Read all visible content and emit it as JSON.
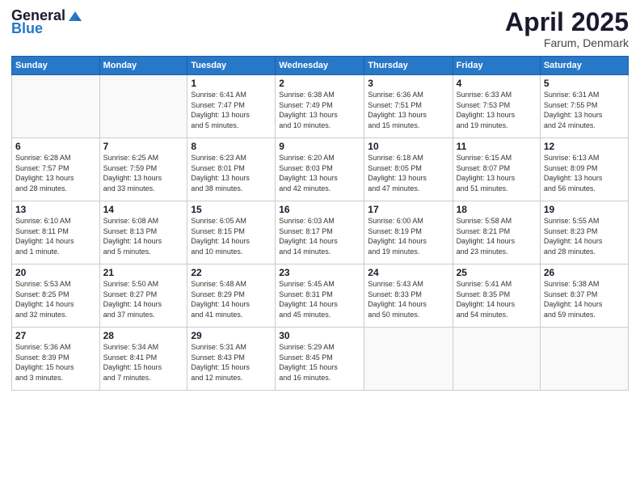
{
  "header": {
    "logo_general": "General",
    "logo_blue": "Blue",
    "month": "April 2025",
    "location": "Farum, Denmark"
  },
  "days_of_week": [
    "Sunday",
    "Monday",
    "Tuesday",
    "Wednesday",
    "Thursday",
    "Friday",
    "Saturday"
  ],
  "weeks": [
    [
      {
        "num": "",
        "info": ""
      },
      {
        "num": "",
        "info": ""
      },
      {
        "num": "1",
        "info": "Sunrise: 6:41 AM\nSunset: 7:47 PM\nDaylight: 13 hours\nand 5 minutes."
      },
      {
        "num": "2",
        "info": "Sunrise: 6:38 AM\nSunset: 7:49 PM\nDaylight: 13 hours\nand 10 minutes."
      },
      {
        "num": "3",
        "info": "Sunrise: 6:36 AM\nSunset: 7:51 PM\nDaylight: 13 hours\nand 15 minutes."
      },
      {
        "num": "4",
        "info": "Sunrise: 6:33 AM\nSunset: 7:53 PM\nDaylight: 13 hours\nand 19 minutes."
      },
      {
        "num": "5",
        "info": "Sunrise: 6:31 AM\nSunset: 7:55 PM\nDaylight: 13 hours\nand 24 minutes."
      }
    ],
    [
      {
        "num": "6",
        "info": "Sunrise: 6:28 AM\nSunset: 7:57 PM\nDaylight: 13 hours\nand 28 minutes."
      },
      {
        "num": "7",
        "info": "Sunrise: 6:25 AM\nSunset: 7:59 PM\nDaylight: 13 hours\nand 33 minutes."
      },
      {
        "num": "8",
        "info": "Sunrise: 6:23 AM\nSunset: 8:01 PM\nDaylight: 13 hours\nand 38 minutes."
      },
      {
        "num": "9",
        "info": "Sunrise: 6:20 AM\nSunset: 8:03 PM\nDaylight: 13 hours\nand 42 minutes."
      },
      {
        "num": "10",
        "info": "Sunrise: 6:18 AM\nSunset: 8:05 PM\nDaylight: 13 hours\nand 47 minutes."
      },
      {
        "num": "11",
        "info": "Sunrise: 6:15 AM\nSunset: 8:07 PM\nDaylight: 13 hours\nand 51 minutes."
      },
      {
        "num": "12",
        "info": "Sunrise: 6:13 AM\nSunset: 8:09 PM\nDaylight: 13 hours\nand 56 minutes."
      }
    ],
    [
      {
        "num": "13",
        "info": "Sunrise: 6:10 AM\nSunset: 8:11 PM\nDaylight: 14 hours\nand 1 minute."
      },
      {
        "num": "14",
        "info": "Sunrise: 6:08 AM\nSunset: 8:13 PM\nDaylight: 14 hours\nand 5 minutes."
      },
      {
        "num": "15",
        "info": "Sunrise: 6:05 AM\nSunset: 8:15 PM\nDaylight: 14 hours\nand 10 minutes."
      },
      {
        "num": "16",
        "info": "Sunrise: 6:03 AM\nSunset: 8:17 PM\nDaylight: 14 hours\nand 14 minutes."
      },
      {
        "num": "17",
        "info": "Sunrise: 6:00 AM\nSunset: 8:19 PM\nDaylight: 14 hours\nand 19 minutes."
      },
      {
        "num": "18",
        "info": "Sunrise: 5:58 AM\nSunset: 8:21 PM\nDaylight: 14 hours\nand 23 minutes."
      },
      {
        "num": "19",
        "info": "Sunrise: 5:55 AM\nSunset: 8:23 PM\nDaylight: 14 hours\nand 28 minutes."
      }
    ],
    [
      {
        "num": "20",
        "info": "Sunrise: 5:53 AM\nSunset: 8:25 PM\nDaylight: 14 hours\nand 32 minutes."
      },
      {
        "num": "21",
        "info": "Sunrise: 5:50 AM\nSunset: 8:27 PM\nDaylight: 14 hours\nand 37 minutes."
      },
      {
        "num": "22",
        "info": "Sunrise: 5:48 AM\nSunset: 8:29 PM\nDaylight: 14 hours\nand 41 minutes."
      },
      {
        "num": "23",
        "info": "Sunrise: 5:45 AM\nSunset: 8:31 PM\nDaylight: 14 hours\nand 45 minutes."
      },
      {
        "num": "24",
        "info": "Sunrise: 5:43 AM\nSunset: 8:33 PM\nDaylight: 14 hours\nand 50 minutes."
      },
      {
        "num": "25",
        "info": "Sunrise: 5:41 AM\nSunset: 8:35 PM\nDaylight: 14 hours\nand 54 minutes."
      },
      {
        "num": "26",
        "info": "Sunrise: 5:38 AM\nSunset: 8:37 PM\nDaylight: 14 hours\nand 59 minutes."
      }
    ],
    [
      {
        "num": "27",
        "info": "Sunrise: 5:36 AM\nSunset: 8:39 PM\nDaylight: 15 hours\nand 3 minutes."
      },
      {
        "num": "28",
        "info": "Sunrise: 5:34 AM\nSunset: 8:41 PM\nDaylight: 15 hours\nand 7 minutes."
      },
      {
        "num": "29",
        "info": "Sunrise: 5:31 AM\nSunset: 8:43 PM\nDaylight: 15 hours\nand 12 minutes."
      },
      {
        "num": "30",
        "info": "Sunrise: 5:29 AM\nSunset: 8:45 PM\nDaylight: 15 hours\nand 16 minutes."
      },
      {
        "num": "",
        "info": ""
      },
      {
        "num": "",
        "info": ""
      },
      {
        "num": "",
        "info": ""
      }
    ]
  ]
}
